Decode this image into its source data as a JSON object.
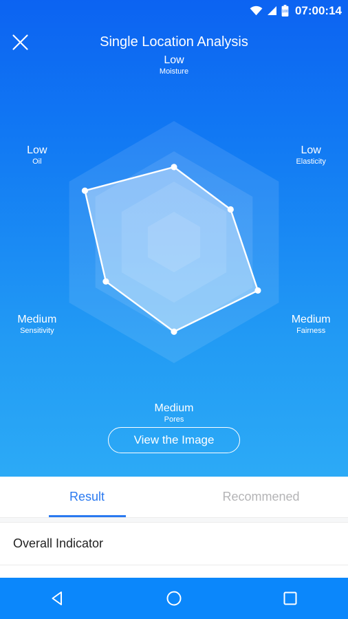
{
  "statusbar": {
    "time": "07:00:14",
    "battery_text": "100",
    "icons": [
      "wifi-icon",
      "cellular-signal-icon",
      "battery-icon"
    ]
  },
  "appbar": {
    "title": "Single Location Analysis",
    "close_icon": "close-icon"
  },
  "chart_data": {
    "type": "radar",
    "title": "Single Location Analysis",
    "rings": 4,
    "axes": [
      "Moisture",
      "Elasticity",
      "Fairness",
      "Pores",
      "Sensitivity",
      "Oil"
    ],
    "categories": [
      "Moisture",
      "Elasticity",
      "Fairness",
      "Pores",
      "Sensitivity",
      "Oil"
    ],
    "level_labels": [
      "Low",
      "Low",
      "Medium",
      "Medium",
      "Medium",
      "Low"
    ],
    "values": [
      0.62,
      0.54,
      0.8,
      0.74,
      0.65,
      0.85
    ],
    "scale_max": 1.0,
    "series": [
      {
        "name": "Single Location",
        "values": [
          0.62,
          0.54,
          0.8,
          0.74,
          0.65,
          0.85
        ]
      }
    ],
    "points": [
      {
        "axis": "Moisture",
        "level": "Low",
        "value": 0.62
      },
      {
        "axis": "Elasticity",
        "level": "Low",
        "value": 0.54
      },
      {
        "axis": "Fairness",
        "level": "Medium",
        "value": 0.8
      },
      {
        "axis": "Pores",
        "level": "Medium",
        "value": 0.74
      },
      {
        "axis": "Sensitivity",
        "level": "Medium",
        "value": 0.65
      },
      {
        "axis": "Oil",
        "level": "Low",
        "value": 0.85
      }
    ],
    "legend": [],
    "grid": true,
    "colors": {
      "series_stroke": "#ffffff",
      "series_fill": "#ffffff",
      "background_top": "#0c63f2",
      "background_bottom": "#2caaf6"
    }
  },
  "radar_labels": [
    {
      "level": "Low",
      "name": "Moisture"
    },
    {
      "level": "Low",
      "name": "Elasticity"
    },
    {
      "level": "Medium",
      "name": "Fairness"
    },
    {
      "level": "Medium",
      "name": "Pores"
    },
    {
      "level": "Medium",
      "name": "Sensitivity"
    },
    {
      "level": "Low",
      "name": "Oil"
    }
  ],
  "actions": {
    "view_image_label": "View the Image"
  },
  "tabs": [
    {
      "label": "Result",
      "active": true
    },
    {
      "label": "Recommened",
      "active": false
    }
  ],
  "content": {
    "overall_indicator_label": "Overall Indicator"
  },
  "navbar": {
    "back_icon": "back-triangle-icon",
    "home_icon": "home-circle-icon",
    "recents_icon": "recents-square-icon"
  },
  "colors": {
    "accent": "#2979f0",
    "navbar": "#0b87fb",
    "tab_inactive": "#b4b4b6"
  }
}
